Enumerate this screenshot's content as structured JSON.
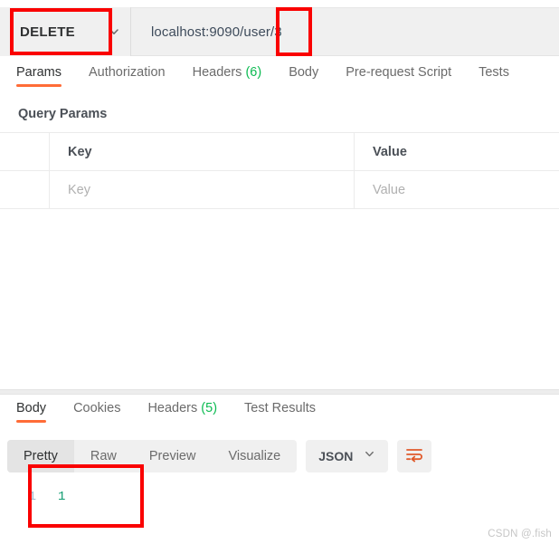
{
  "request_bar": {
    "method": "DELETE",
    "method_chevron_icon": "chevron-down-icon",
    "url": "localhost:9090/user/3"
  },
  "request_tabs": [
    {
      "label": "Params",
      "active": true
    },
    {
      "label": "Authorization",
      "active": false
    },
    {
      "label": "Headers",
      "count": "(6)",
      "active": false
    },
    {
      "label": "Body",
      "active": false
    },
    {
      "label": "Pre-request Script",
      "active": false
    },
    {
      "label": "Tests",
      "active": false
    }
  ],
  "query_params": {
    "section_label": "Query Params",
    "columns": [
      "Key",
      "Value"
    ],
    "rows": [
      {
        "key_placeholder": "Key",
        "value_placeholder": "Value"
      }
    ]
  },
  "response_tabs": [
    {
      "label": "Body",
      "active": true
    },
    {
      "label": "Cookies",
      "active": false
    },
    {
      "label": "Headers",
      "count": "(5)",
      "active": false
    },
    {
      "label": "Test Results",
      "active": false
    }
  ],
  "response_toolbar": {
    "views": [
      {
        "label": "Pretty",
        "active": true
      },
      {
        "label": "Raw",
        "active": false
      },
      {
        "label": "Preview",
        "active": false
      },
      {
        "label": "Visualize",
        "active": false
      }
    ],
    "format": "JSON",
    "format_chevron_icon": "chevron-down-icon",
    "wrap_icon": "word-wrap-icon"
  },
  "response_body": {
    "lines": [
      {
        "number": "1",
        "content": "1"
      }
    ]
  },
  "watermark": "CSDN @.fish",
  "colors": {
    "accent": "#ff6c37",
    "count_green": "#0cbb52",
    "annotation_red": "#fa0101",
    "json_number": "#0f9b70",
    "gutter": "#9bb7cc"
  }
}
